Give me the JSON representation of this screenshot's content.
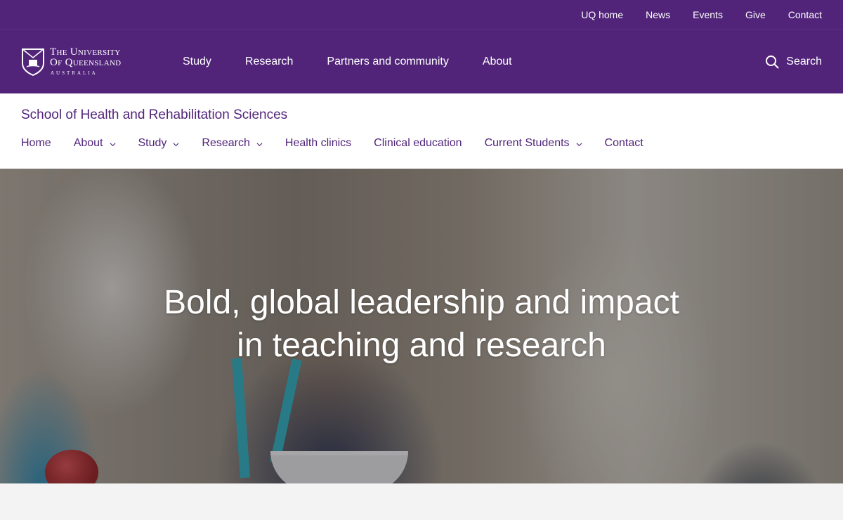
{
  "utility_nav": [
    "UQ home",
    "News",
    "Events",
    "Give",
    "Contact"
  ],
  "logo": {
    "line1": "The University",
    "line2": "Of Queensland",
    "line3": "AUSTRALIA"
  },
  "main_nav": [
    "Study",
    "Research",
    "Partners and community",
    "About"
  ],
  "search": {
    "label": "Search",
    "icon": "search-icon"
  },
  "site_title": "School of Health and Rehabilitation Sciences",
  "local_nav": [
    {
      "label": "Home",
      "dropdown": false
    },
    {
      "label": "About",
      "dropdown": true
    },
    {
      "label": "Study",
      "dropdown": true
    },
    {
      "label": "Research",
      "dropdown": true
    },
    {
      "label": "Health clinics",
      "dropdown": false
    },
    {
      "label": "Clinical education",
      "dropdown": false
    },
    {
      "label": "Current Students",
      "dropdown": true
    },
    {
      "label": "Contact",
      "dropdown": false
    }
  ],
  "hero": {
    "heading_line1": "Bold, global leadership and impact",
    "heading_line2": "in teaching and research"
  },
  "colors": {
    "brand_purple": "#51247a",
    "white": "#ffffff",
    "page_bg": "#f3f3f3"
  }
}
